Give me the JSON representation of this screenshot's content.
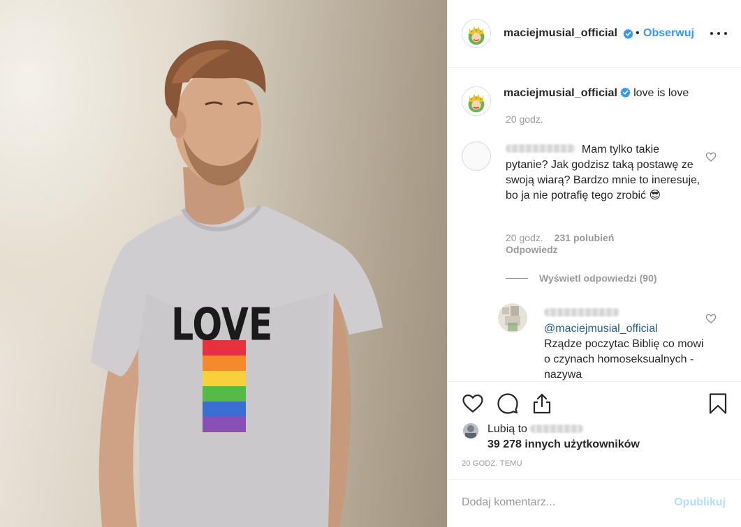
{
  "post": {
    "photo_alt": "",
    "shirt_text": "LOVE",
    "colors": {
      "accent": "#3897f0",
      "text": "#262626",
      "muted": "#999999",
      "publish_disabled": "#b2dffc",
      "border": "#efefef",
      "rainbow": [
        "#e8313f",
        "#f58a2c",
        "#f7d13a",
        "#57b947",
        "#3a6fd1",
        "#8a4fb6"
      ]
    }
  },
  "header": {
    "username": "maciejmusial_official",
    "verified_icon": "verified-badge-icon",
    "separator": "•",
    "follow_label": "Obserwuj",
    "more_icon": "more-options-icon"
  },
  "caption": {
    "username": "maciejmusial_official",
    "text": "love is love",
    "time": "20 godz."
  },
  "comments": [
    {
      "username_blurred": true,
      "text": "Mam tylko takie pytanie? Jak godzisz taką postawę ze swoją wiarą? Bardzo mnie to ineresuje, bo ja nie potrafię tego zrobić 😎",
      "time": "20 godz.",
      "likes": "231 polubień",
      "reply_label": "Odpowiedz",
      "view_replies": "Wyświetl odpowiedzi (90)"
    },
    {
      "username_blurred": true,
      "mention": "@maciejmusial_official",
      "text": "Rządze poczytac Biblię co mowi o czynach homoseksualnych - nazywa"
    }
  ],
  "actions": {
    "like_icon": "heart-icon",
    "comment_icon": "comment-icon",
    "share_icon": "share-icon",
    "save_icon": "bookmark-icon"
  },
  "likes": {
    "prefix": "Lubią to",
    "count_text": "39 278 innych użytkowników"
  },
  "timestamp": "20 GODZ. TEMU",
  "add_comment": {
    "placeholder": "Dodaj komentarz...",
    "publish_label": "Opublikuj"
  }
}
